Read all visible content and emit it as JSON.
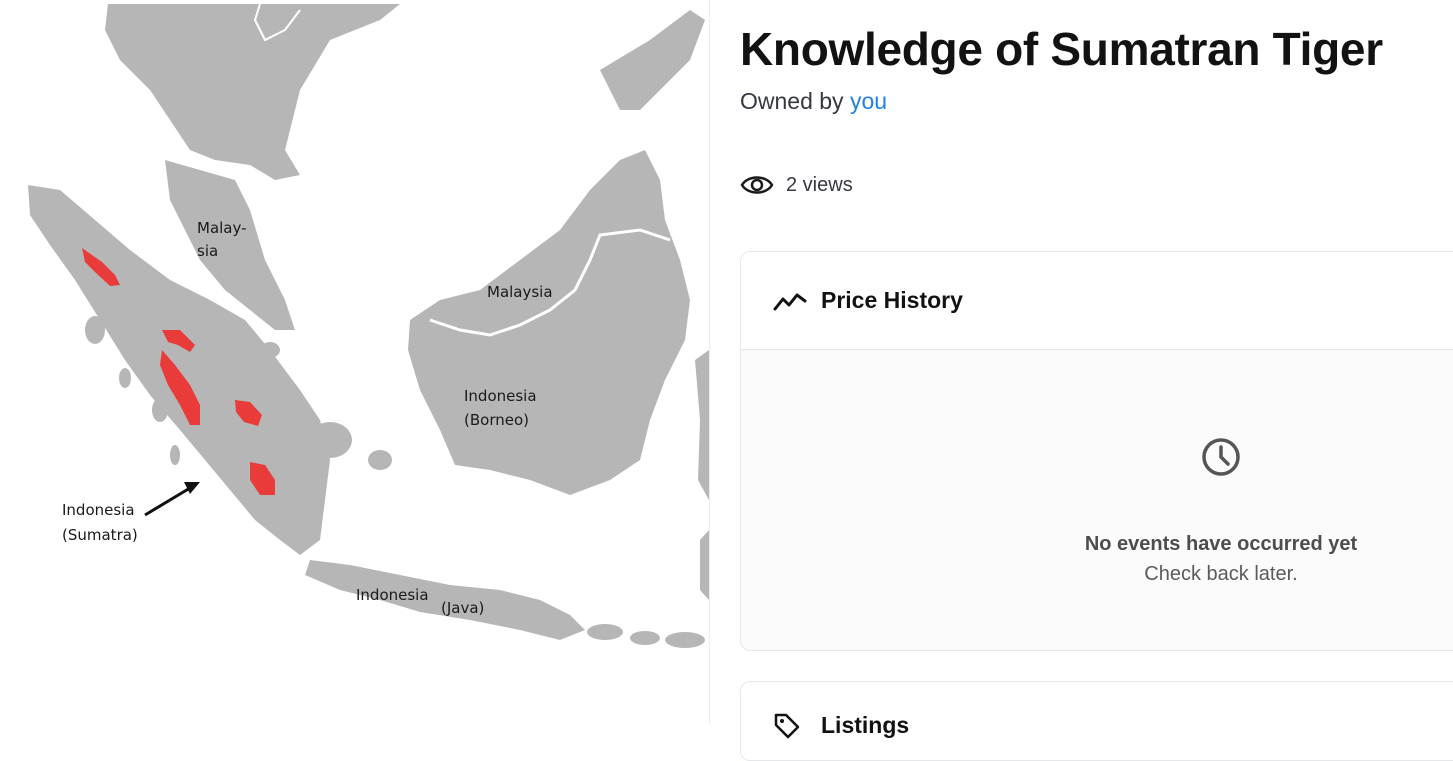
{
  "map": {
    "labels": {
      "malaysia_peninsula_line1": "Malay-",
      "malaysia_peninsula_line2": "sia",
      "malaysia_borneo": "Malaysia",
      "indonesia_borneo_line1": "Indonesia",
      "indonesia_borneo_line2": "(Borneo)",
      "indonesia_sumatra_line1": "Indonesia",
      "indonesia_sumatra_line2": "(Sumatra)",
      "indonesia_java_line1": "Indonesia",
      "indonesia_java_line2": "(Java)"
    },
    "colors": {
      "land": "#b6b6b6",
      "sea": "#ffffff",
      "border": "#ffffff",
      "tiger_range": "#ea3b3b",
      "arrow": "#111111"
    }
  },
  "item": {
    "title": "Knowledge of Sumatran Tiger",
    "owned_by_prefix": "Owned by",
    "owner": "you",
    "views_text": "2 views"
  },
  "price_history": {
    "title": "Price History",
    "icon": "trending-line-icon",
    "empty_icon": "clock-icon",
    "empty_title": "No events have occurred yet",
    "empty_subtitle": "Check back later."
  },
  "listings": {
    "title": "Listings",
    "icon": "tag-icon"
  },
  "colors": {
    "link": "#2081e2",
    "text": "#121212",
    "border": "#e5e8eb"
  }
}
